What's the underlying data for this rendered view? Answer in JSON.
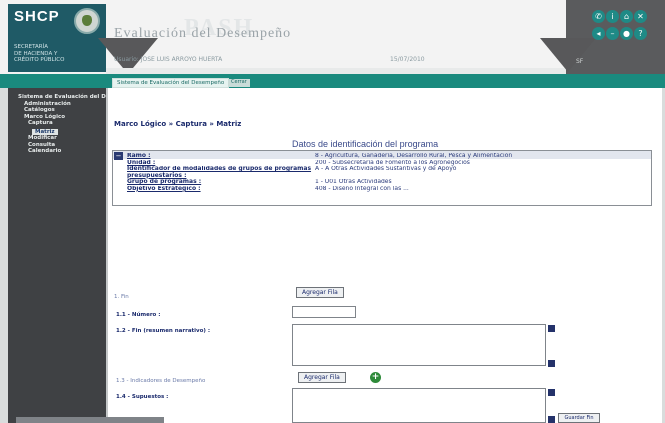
{
  "header": {
    "logo": "SHCP",
    "agency_lines": [
      "SECRETARÍA",
      "DE HACIENDA Y",
      "CRÉDITO PÚBLICO"
    ],
    "app_title": "Evaluación del Desempeño",
    "watermark": "PASH",
    "user_line": "Usuario: JOSE LUIS ARROYO HUERTA",
    "date_line": "15/07/2010",
    "right_label": "SF",
    "icons": [
      "phone-icon",
      "info-icon",
      "home-icon",
      "close-icon",
      "back-icon",
      "minus-icon",
      "settings-icon",
      "help-icon"
    ]
  },
  "tabs": {
    "main": "Sistema de Evaluación del Desempeño",
    "close": "Cerrar"
  },
  "sidebar": {
    "items": [
      {
        "label": "Sistema de Evaluación del Desempeño",
        "level": 0
      },
      {
        "label": "Administración",
        "level": 1
      },
      {
        "label": "Catálogos",
        "level": 1
      },
      {
        "label": "Marco Lógico",
        "level": 1
      },
      {
        "label": "Captura",
        "level": 2
      },
      {
        "label": "Matriz",
        "level": 3,
        "selected": true
      },
      {
        "label": "Modificar",
        "level": 2
      },
      {
        "label": "Consulta",
        "level": 2
      },
      {
        "label": "Calendario",
        "level": 2
      }
    ]
  },
  "main": {
    "breadcrumb": "Marco Lógico » Captura » Matriz",
    "section_title": "Datos de identificación del programa",
    "id_fields": [
      {
        "label": "Ramo :",
        "value": "8 - Agricultura, Ganadería, Desarrollo Rural, Pesca y Alimentación"
      },
      {
        "label": "Unidad :",
        "value": "200 - Subsecretaría de Fomento a los Agronegocios"
      },
      {
        "label": "Identificador de modalidades de grupos de programas presupuestarios :",
        "value": "A - A Otras Actividades Sustantivas y de Apoyo"
      },
      {
        "label": "",
        "value": ""
      },
      {
        "label": "Grupo de programas :",
        "value": "1 - U01 Otras Actividades"
      },
      {
        "label": "Objetivo Estratégico :",
        "value": "408 - Diseño Integral con las ..."
      }
    ],
    "form": {
      "fin_label": "1. Fin",
      "add_row_1": "Agregar Fila",
      "num_label": "1.1 - Número :",
      "desc_label": "1.2 - Fin (resumen narrativo) :",
      "indicator_label": "1.3 - Indicadores de Desempeño",
      "add_row_2": "Agregar Fila",
      "supuestos_label": "1.4 - Supuestos :",
      "save_label": "Guardar Fin"
    }
  }
}
